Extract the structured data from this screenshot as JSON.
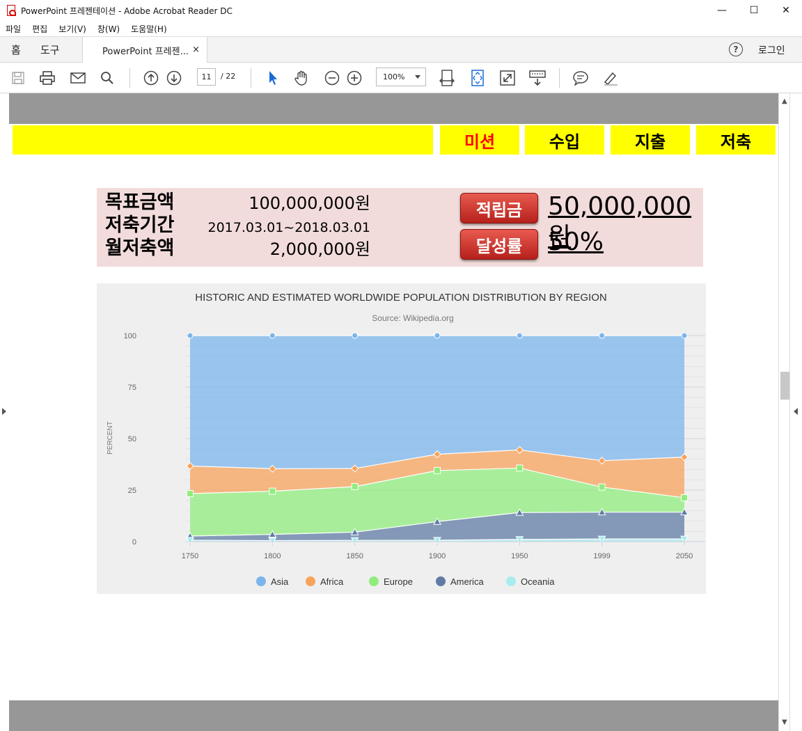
{
  "window": {
    "title": "PowerPoint 프레젠테이션 - Adobe Acrobat Reader DC",
    "controls": [
      "—",
      "☐",
      "✕"
    ]
  },
  "menu": [
    "파일",
    "편집",
    "보기(V)",
    "창(W)",
    "도움말(H)"
  ],
  "tabs": {
    "home": "홈",
    "tools": "도구",
    "document": "PowerPoint 프레젠...",
    "close": "×",
    "help": "?",
    "login": "로그인"
  },
  "toolbar": {
    "page_current": "11",
    "page_total": "/ 22",
    "zoom": "100%"
  },
  "slide": {
    "nav": [
      "미션",
      "수입",
      "지출",
      "저축"
    ],
    "active_nav": "미션",
    "summary": {
      "goal_label": "목표금액",
      "goal_value": "100,000,000원",
      "period_label": "저축기간",
      "period_value": "2017.03.01~2018.03.01",
      "monthly_label": "월저축액",
      "monthly_value": "2,000,000원",
      "saved_button": "적립금",
      "saved_value": "50,000,000원",
      "rate_button": "달성률",
      "rate_value": "50%"
    }
  },
  "chart_data": {
    "type": "area",
    "title": "HISTORIC AND ESTIMATED WORLDWIDE POPULATION DISTRIBUTION BY REGION",
    "subtitle": "Source: Wikipedia.org",
    "ylabel": "PERCENT",
    "xlabel": "",
    "stacked": true,
    "ylim": [
      0,
      100
    ],
    "yticks": [
      0,
      25,
      50,
      75,
      100
    ],
    "x": [
      "1750",
      "1800",
      "1850",
      "1900",
      "1950",
      "1999",
      "2050"
    ],
    "series": [
      {
        "name": "Asia",
        "color": "#7cb5ec",
        "values": [
          63.3,
          64.6,
          64.5,
          57.6,
          55.5,
          60.7,
          59.0
        ]
      },
      {
        "name": "Africa",
        "color": "#f7a35c",
        "values": [
          13.4,
          10.9,
          8.8,
          7.9,
          8.8,
          12.8,
          19.7
        ]
      },
      {
        "name": "Europe",
        "color": "#90ed7d",
        "values": [
          20.6,
          21.0,
          22.1,
          24.8,
          21.6,
          12.2,
          7.0
        ]
      },
      {
        "name": "America",
        "color": "#607ca6",
        "values": [
          2.0,
          3.0,
          4.0,
          9.0,
          13.0,
          13.0,
          13.0
        ]
      },
      {
        "name": "Oceania",
        "color": "#a8ecee",
        "values": [
          0.7,
          0.5,
          0.6,
          0.7,
          1.1,
          1.3,
          1.3
        ]
      }
    ],
    "legend": "bottom-center",
    "grid": true
  }
}
